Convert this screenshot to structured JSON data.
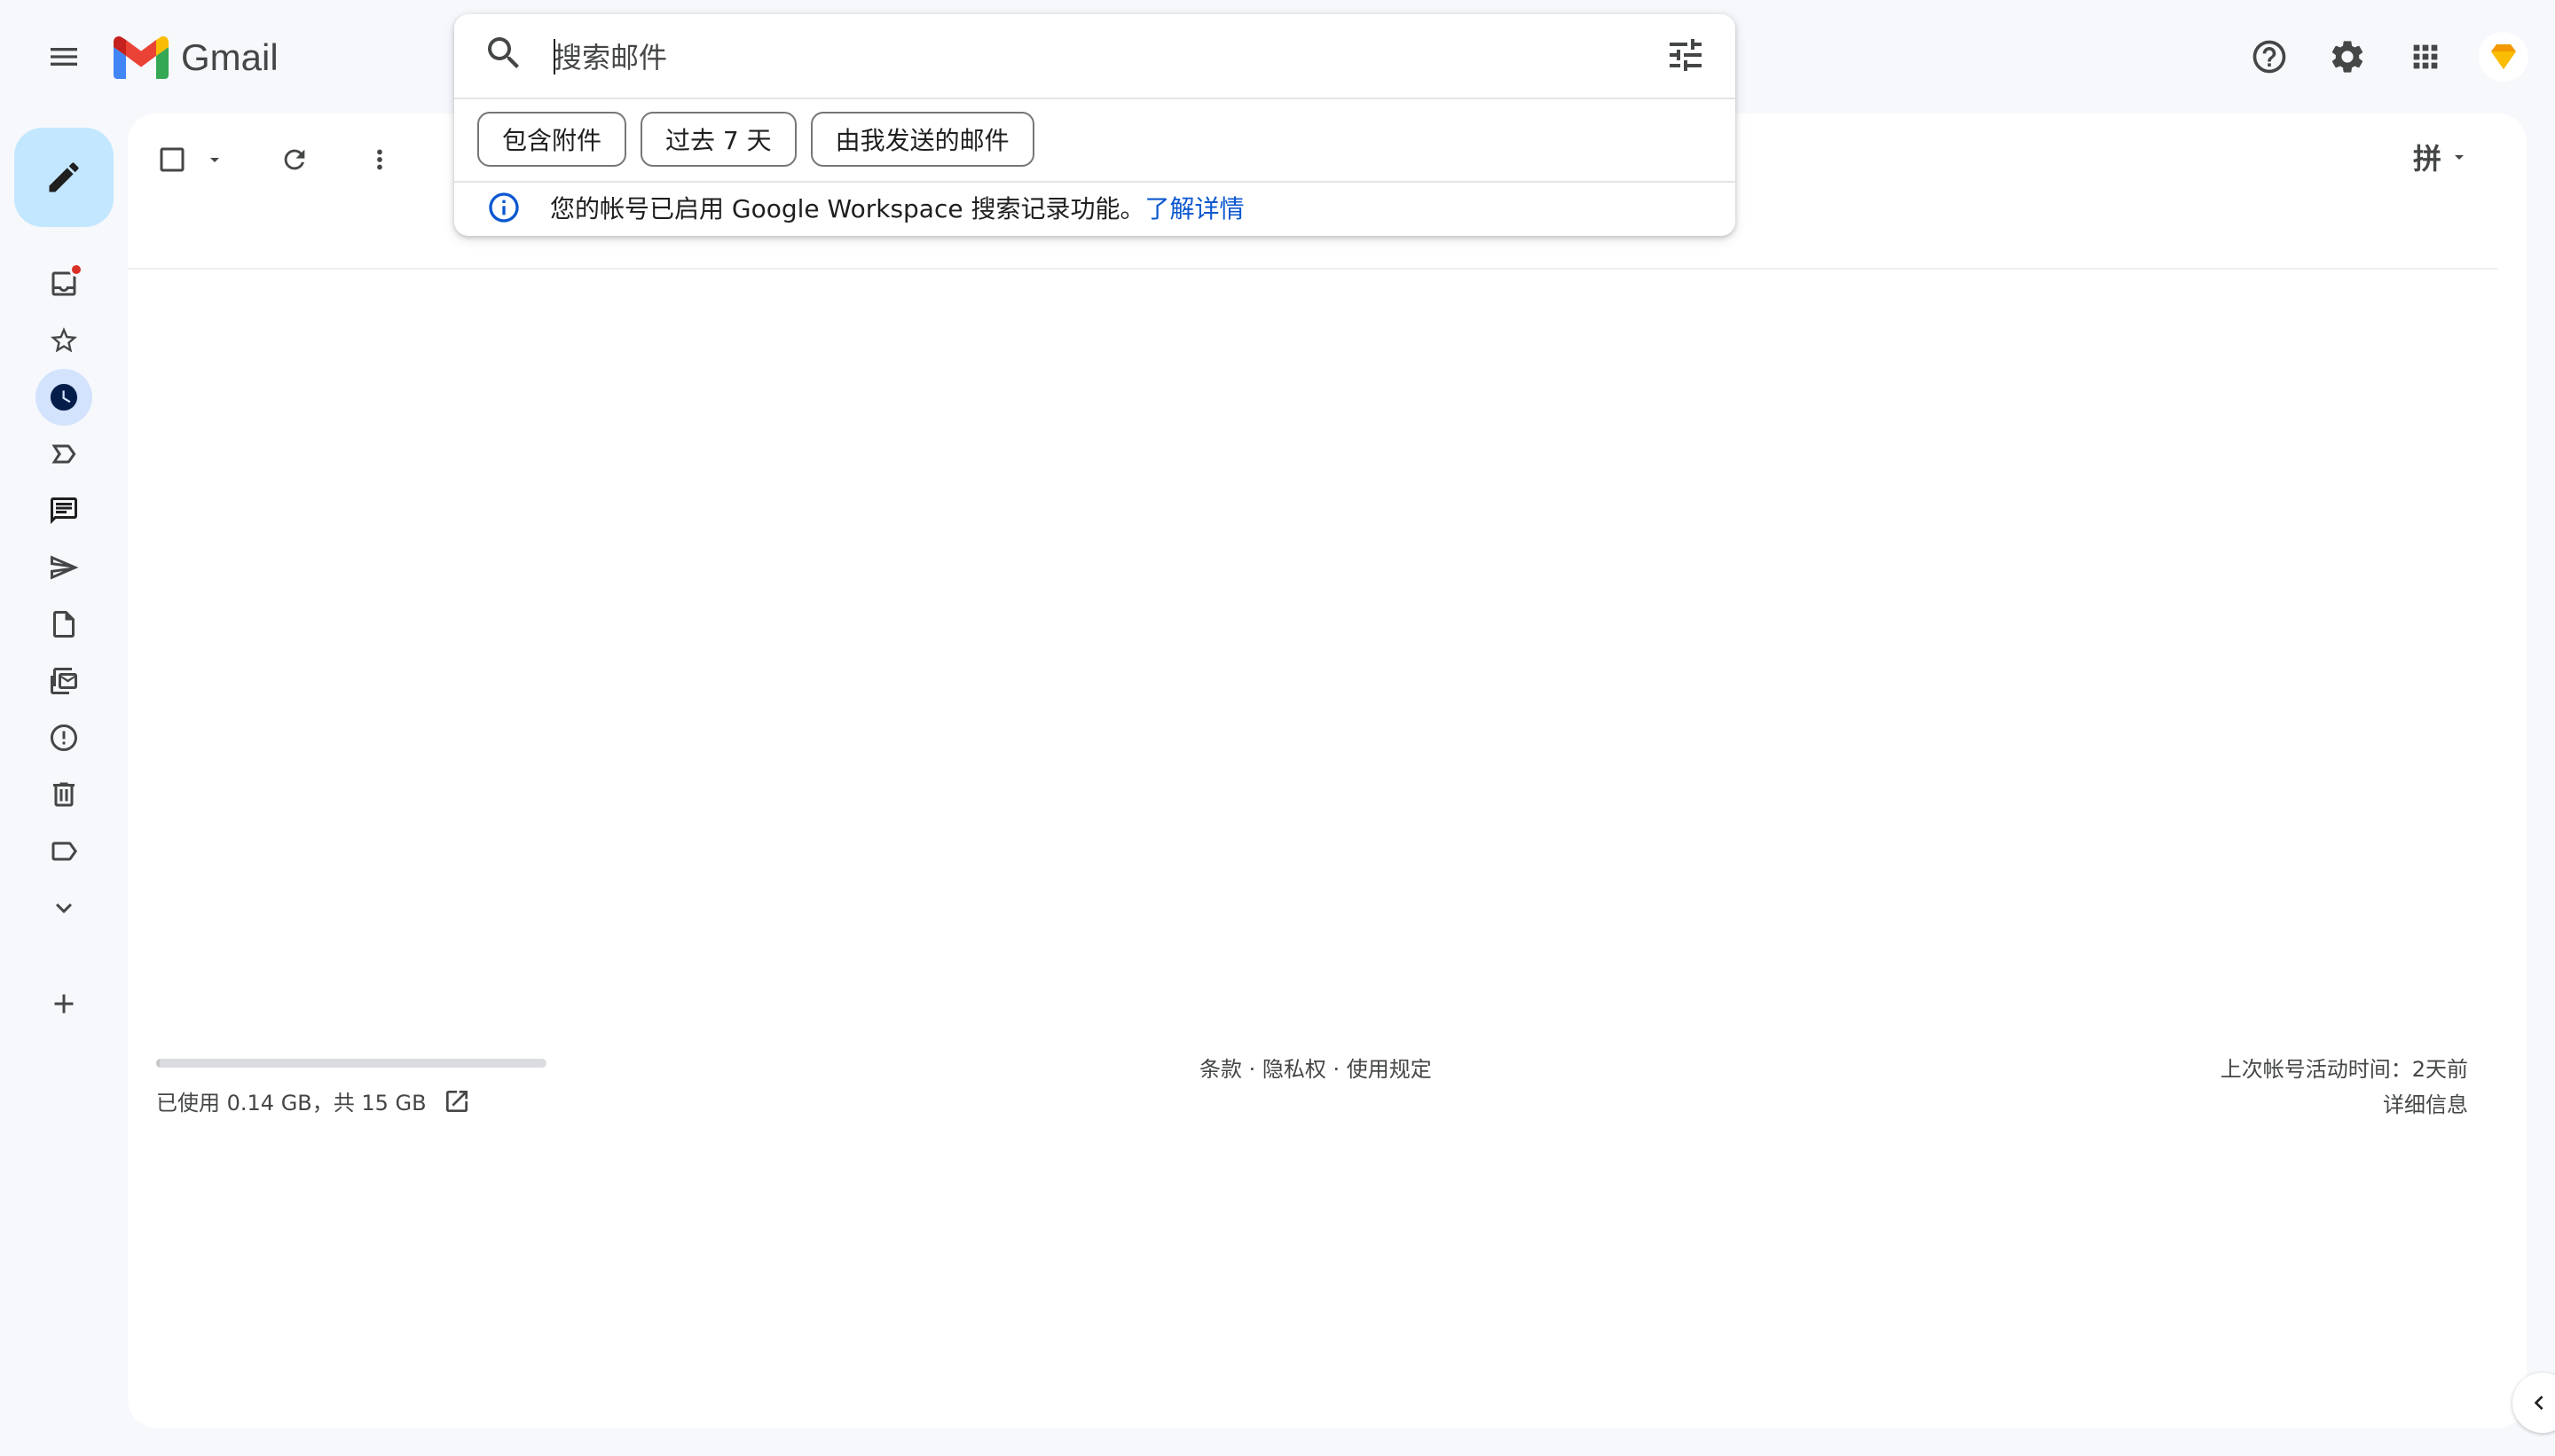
{
  "app": {
    "name": "Gmail"
  },
  "search": {
    "placeholder": "搜索邮件",
    "chips": [
      "包含附件",
      "过去 7 天",
      "由我发送的邮件"
    ],
    "notice_text": "您的帐号已启用 Google Workspace 搜索记录功能。",
    "notice_link": "了解详情"
  },
  "toolbar": {
    "ime_label": "拼"
  },
  "rail": {
    "icons": [
      "inbox-icon",
      "star-icon",
      "clock-icon",
      "label-important-icon",
      "chat-icon",
      "send-icon",
      "draft-icon",
      "all-mail-icon",
      "spam-icon",
      "trash-icon",
      "label-icon",
      "expand-more-icon"
    ]
  },
  "footer": {
    "storage_text": "已使用 0.14 GB，共 15 GB",
    "storage_fraction": 0.01,
    "links": "条款 · 隐私权 · 使用规定",
    "last_activity": "上次帐号活动时间：2天前",
    "details": "详细信息"
  },
  "colors": {
    "background": "#f6f8fc",
    "compose": "#c2e7ff",
    "active_rail": "#d3e3fd",
    "link": "#0b57d0",
    "badge": "#d93025"
  }
}
